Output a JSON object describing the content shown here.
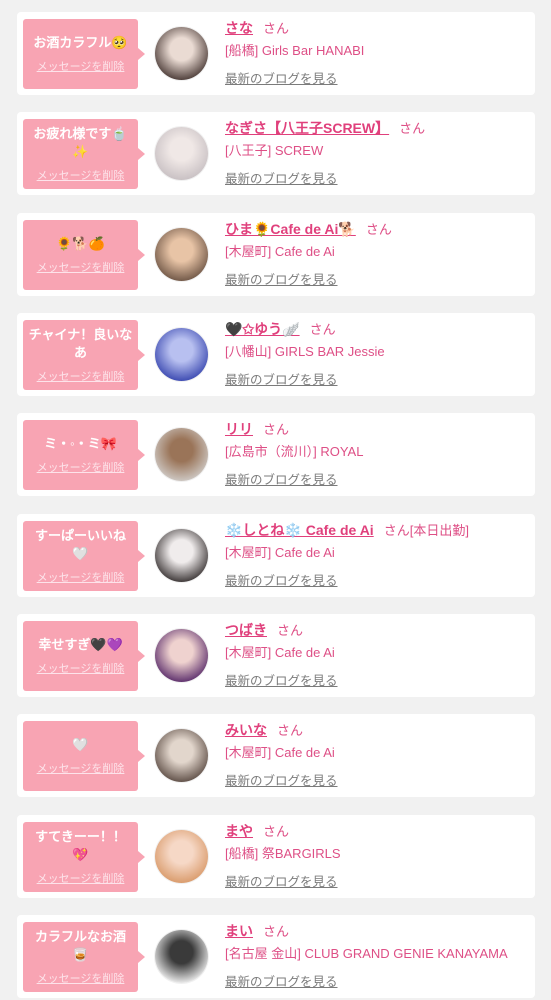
{
  "labels": {
    "honorific": "さん",
    "delete_message": "メッセージを削除",
    "latest_blog": "最新のブログを見る"
  },
  "theme": {
    "page_bg": "#f1f1f1",
    "card_bg": "#ffffff",
    "bubble_bg": "#f8a4b3",
    "bubble_text": "#ffffff",
    "bubble_link": "#fde3ea",
    "name": "#e0407c",
    "shop": "#de4f86",
    "link": "#7b7b7b"
  },
  "cards": [
    {
      "message": "お酒カラフル🥺",
      "name": "さな",
      "shop": "[船橋] Girls Bar HANABI",
      "avatar_colors": [
        "#eadbd3",
        "#4a3a36"
      ]
    },
    {
      "message": "お疲れ様です🍵✨",
      "name": "なぎさ【八王子SCREW】",
      "shop": "[八王子] SCREW",
      "avatar_colors": [
        "#f0e8e6",
        "#c7bfc2"
      ]
    },
    {
      "message": "🌻🐕🍊",
      "name": "ひま🌻Cafe de Ai🐕",
      "shop": "[木屋町] Cafe de Ai",
      "avatar_colors": [
        "#e8c4a6",
        "#6e5545"
      ]
    },
    {
      "message": "チャイナ！良いなあ",
      "name": "🖤✩ゆう🪽",
      "shop": "[八幡山] GIRLS BAR Jessie",
      "avatar_colors": [
        "#b8c0f0",
        "#3a48b0"
      ]
    },
    {
      "message": "ミ・◦・ミ🎀",
      "name": "リリ",
      "shop": "[広島市（流川）] ROYAL",
      "avatar_colors": [
        "#9a7458",
        "#cfcac6"
      ]
    },
    {
      "message": "すーぱーいいね🤍",
      "name": "❄️しとね❄️ Cafe de Ai",
      "status": "[本日出勤]",
      "shop": "[木屋町] Cafe de Ai",
      "avatar_colors": [
        "#f0ecec",
        "#3a3434"
      ]
    },
    {
      "message": "幸せすぎ🖤💜",
      "name": "つばき",
      "shop": "[木屋町] Cafe de Ai",
      "avatar_colors": [
        "#efd2cf",
        "#5b2d6b"
      ]
    },
    {
      "message": "🤍",
      "name": "みいな",
      "shop": "[木屋町] Cafe de Ai",
      "avatar_colors": [
        "#e2d6cc",
        "#5e4e46"
      ]
    },
    {
      "message": "すてきーー！！💖",
      "name": "まや",
      "shop": "[船橋] 祭BARGIRLS",
      "avatar_colors": [
        "#f6d8c6",
        "#d99a6a"
      ]
    },
    {
      "message": "カラフルなお酒🥃",
      "name": "まい",
      "shop": "[名古屋 金山] CLUB GRAND GENIE KANAYAMA",
      "avatar_colors": [
        "#3a3a3a",
        "#f2f2f2"
      ]
    }
  ]
}
